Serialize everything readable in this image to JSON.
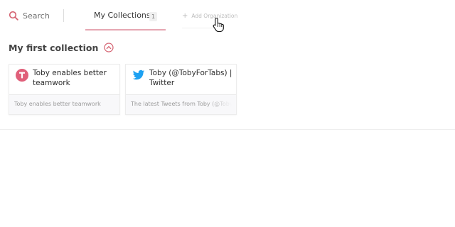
{
  "colors": {
    "accent": "#d4606f",
    "tab_underline": "#e6a6b2",
    "toby_logo": "#e0607a",
    "twitter_blue": "#1da1f2"
  },
  "toolbar": {
    "search_label": "Search",
    "search_icon": "search-icon"
  },
  "tabs": [
    {
      "label": "My Collections",
      "count": "1",
      "active": true
    }
  ],
  "add_organization": {
    "label": "Add Organization",
    "icon": "plus-icon"
  },
  "collection": {
    "title": "My first collection",
    "toggle_icon": "chevron-up-icon",
    "cards": [
      {
        "icon": "toby-logo-icon",
        "title": "Toby enables better teamwork",
        "description": "Toby enables better teamwork"
      },
      {
        "icon": "twitter-bird-icon",
        "title": "Toby (@TobyForTabs) | Twitter",
        "description": "The latest Tweets from Toby (@TobyForTabs)"
      }
    ]
  }
}
